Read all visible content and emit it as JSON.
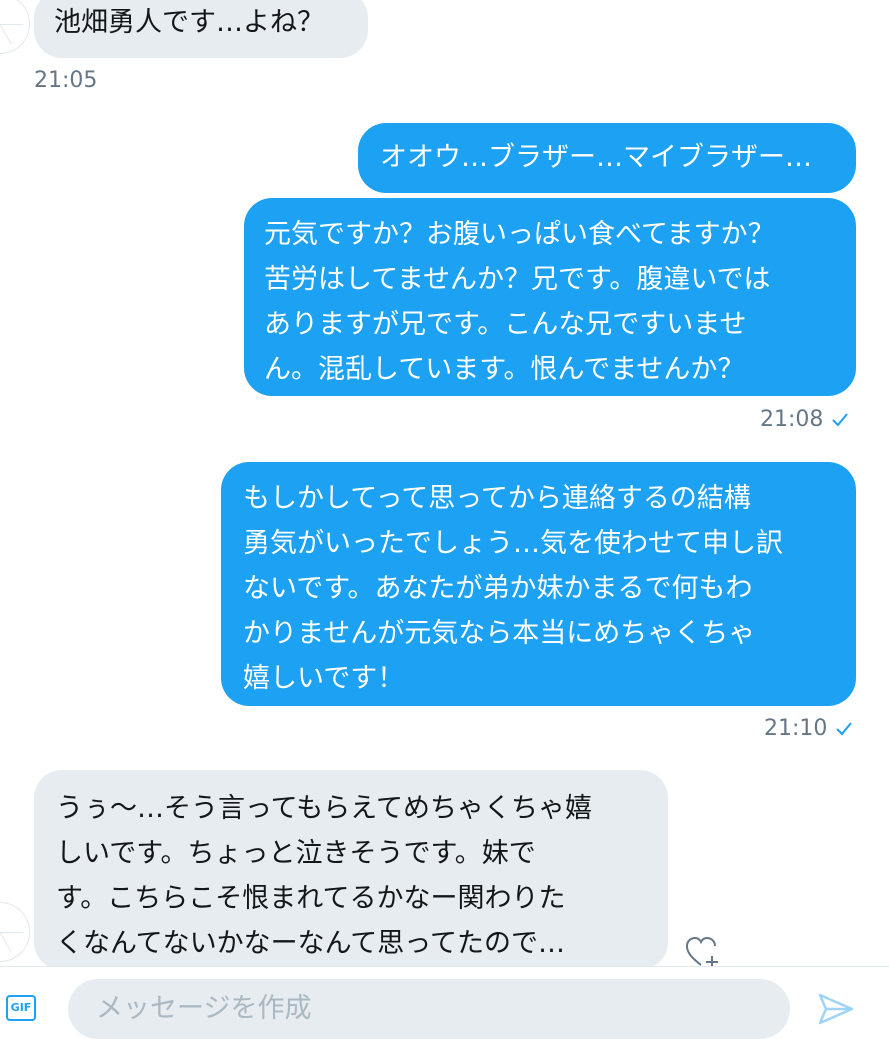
{
  "messages": [
    {
      "side": "in",
      "lines": [
        "池畑勇人です…よね？"
      ]
    },
    {
      "side": "out",
      "lines": [
        "オオウ…ブラザー…マイブラザー…"
      ]
    },
    {
      "side": "out",
      "lines": [
        "元気ですか？お腹いっぱい食べてますか？",
        "苦労はしてませんか？兄です。腹違いでは",
        "ありますが兄です。こんな兄ですいませ",
        "ん。混乱しています。恨んでませんか？"
      ]
    },
    {
      "side": "out",
      "lines": [
        "もしかしてって思ってから連絡するの結構",
        "勇気がいったでしょう…気を使わせて申し訳",
        "ないです。あなたが弟か妹かまるで何もわ",
        "かりませんが元気なら本当にめちゃくちゃ",
        "嬉しいです！"
      ]
    },
    {
      "side": "in",
      "lines": [
        "うぅ〜…そう言ってもらえてめちゃくちゃ嬉",
        "しいです。ちょっと泣きそうです。妹で",
        "す。こちらこそ恨まれてるかなー関わりた",
        "くなんてないかなーなんて思ってたので…"
      ]
    }
  ],
  "timestamps": {
    "t1": "21:05",
    "t2": "21:08",
    "t3": "21:10"
  },
  "composer": {
    "gif_label": "GIF",
    "placeholder": "メッセージを作成"
  },
  "icons": {
    "read_check": "check-icon",
    "react": "heart-plus-icon",
    "send": "send-icon"
  },
  "colors": {
    "accent": "#1da1f2",
    "incoming_bubble": "#e6ecf0",
    "timestamp": "#657786"
  }
}
